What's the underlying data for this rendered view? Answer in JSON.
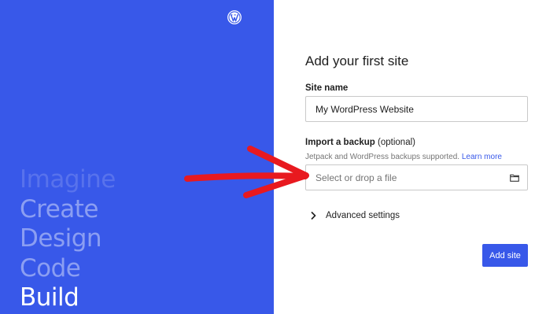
{
  "brand": {
    "logo_icon": "wordpress-logo-icon",
    "panel_color": "#3858e9"
  },
  "hero_words": [
    "Imagine",
    "Create",
    "Design",
    "Code",
    "Build"
  ],
  "form": {
    "title": "Add your first site",
    "site_name": {
      "label": "Site name",
      "value": "My WordPress Website"
    },
    "import_backup": {
      "label": "Import a backup",
      "optional_text": "(optional)",
      "help_text": "Jetpack and WordPress backups supported.",
      "learn_more_label": "Learn more",
      "placeholder": "Select or drop a file",
      "icon": "folder-icon"
    },
    "advanced_settings": {
      "label": "Advanced settings",
      "icon": "chevron-right-icon"
    },
    "submit_label": "Add site",
    "accent_color": "#3858e9"
  },
  "annotation": {
    "icon": "red-arrow-icon",
    "color": "#e8191f"
  }
}
